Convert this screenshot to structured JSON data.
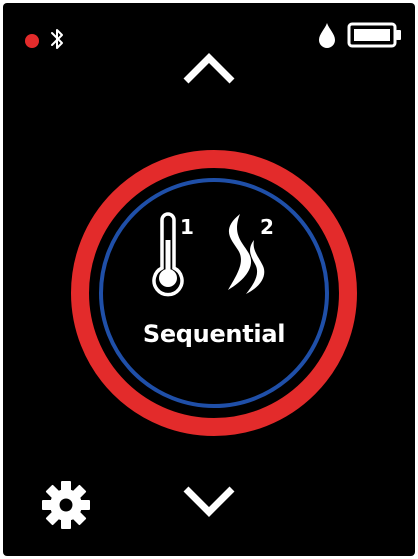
{
  "status": {
    "recording_icon": "red-dot-icon",
    "recording_color": "#e32b2b",
    "bluetooth_icon": "bluetooth-icon",
    "water_icon": "water-drop-icon",
    "battery_icon": "battery-icon",
    "battery_level": 1.0
  },
  "navigation": {
    "up_icon": "chevron-up-icon",
    "down_icon": "chevron-down-icon"
  },
  "dial": {
    "outer_ring_color": "#e32b2b",
    "inner_ring_color": "#1f4fa8",
    "step_1_icon": "thermometer-icon",
    "step_1_number": "1",
    "step_2_icon": "steam-icon",
    "step_2_number": "2",
    "mode_label": "Sequential"
  },
  "settings": {
    "icon": "gear-icon"
  }
}
